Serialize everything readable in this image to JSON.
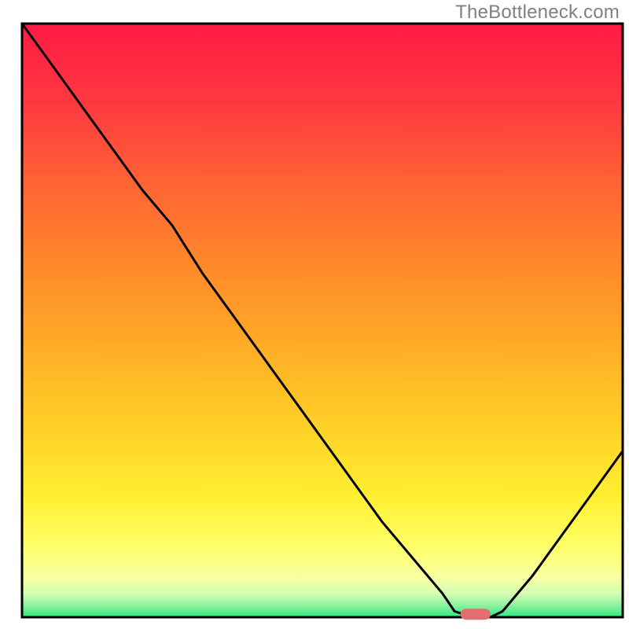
{
  "watermark": "TheBottleneck.com",
  "chart_data": {
    "type": "line",
    "title": "",
    "xlabel": "",
    "ylabel": "",
    "xlim": [
      0,
      100
    ],
    "ylim": [
      0,
      100
    ],
    "x": [
      0,
      5,
      10,
      15,
      20,
      25,
      30,
      35,
      40,
      45,
      50,
      55,
      60,
      65,
      70,
      72,
      75,
      78,
      80,
      85,
      90,
      95,
      100
    ],
    "values": [
      100,
      93,
      86,
      79,
      72,
      66,
      58,
      51,
      44,
      37,
      30,
      23,
      16,
      10,
      4,
      1,
      0,
      0,
      1,
      7,
      14,
      21,
      28
    ],
    "marker": {
      "x_start": 73,
      "x_end": 78,
      "y": 0.5
    },
    "gradient_stops": [
      {
        "offset": 0.0,
        "color": "#ff1a45"
      },
      {
        "offset": 0.14,
        "color": "#ff3a40"
      },
      {
        "offset": 0.28,
        "color": "#ff6633"
      },
      {
        "offset": 0.42,
        "color": "#ff8c2a"
      },
      {
        "offset": 0.55,
        "color": "#ffae26"
      },
      {
        "offset": 0.68,
        "color": "#ffd027"
      },
      {
        "offset": 0.8,
        "color": "#fff033"
      },
      {
        "offset": 0.88,
        "color": "#ffff66"
      },
      {
        "offset": 0.93,
        "color": "#faffa0"
      },
      {
        "offset": 0.96,
        "color": "#d6ffb3"
      },
      {
        "offset": 0.98,
        "color": "#8cf29e"
      },
      {
        "offset": 1.0,
        "color": "#2ee87f"
      }
    ],
    "marker_color": "#e26e6e",
    "curve_color": "#000000",
    "border_color": "#000000"
  }
}
